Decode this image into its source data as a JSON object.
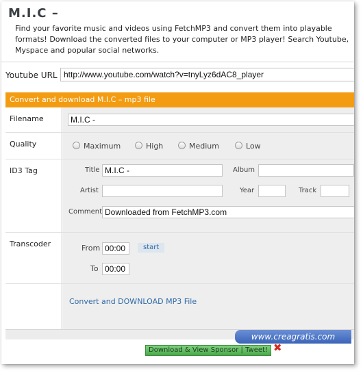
{
  "header": {
    "title": "M.I.C –",
    "intro": "Find your favorite music and videos using FetchMP3 and convert them into playable formats! Download the converted files to your computer or MP3 player! Search Youtube, Myspace and popular social networks."
  },
  "youtube": {
    "label": "Youtube URL",
    "value": "http://www.youtube.com/watch?v=tnyLyz6dAC8_player"
  },
  "section": {
    "title": "Convert and download M.I.C – mp3 file"
  },
  "filename": {
    "label": "Filename",
    "value": "M.I.C -"
  },
  "quality": {
    "label": "Quality",
    "options": [
      "Maximum",
      "High",
      "Medium",
      "Low"
    ]
  },
  "id3": {
    "label": "ID3 Tag",
    "title_label": "Title",
    "title_value": "M.I.C -",
    "album_label": "Album",
    "album_value": "",
    "artist_label": "Artist",
    "artist_value": "",
    "year_label": "Year",
    "year_value": "",
    "track_label": "Track",
    "track_value": "",
    "comment_label": "Comment",
    "comment_value": "Downloaded from FetchMP3.com"
  },
  "transcoder": {
    "label": "Transcoder",
    "from_label": "From",
    "from_value": "00:00",
    "start_label": "start",
    "to_label": "To",
    "to_value": "00:00"
  },
  "download": {
    "link_label": "Convert and DOWNLOAD MP3 File"
  },
  "overlay": {
    "watermark": "www.creagratis.com",
    "sponsor_label": "Download & View Sponsor | Tweet!",
    "close_glyph": "✖"
  },
  "colors": {
    "accent": "#f39c12",
    "link": "#2f6aa5",
    "close": "#d22a1e"
  }
}
